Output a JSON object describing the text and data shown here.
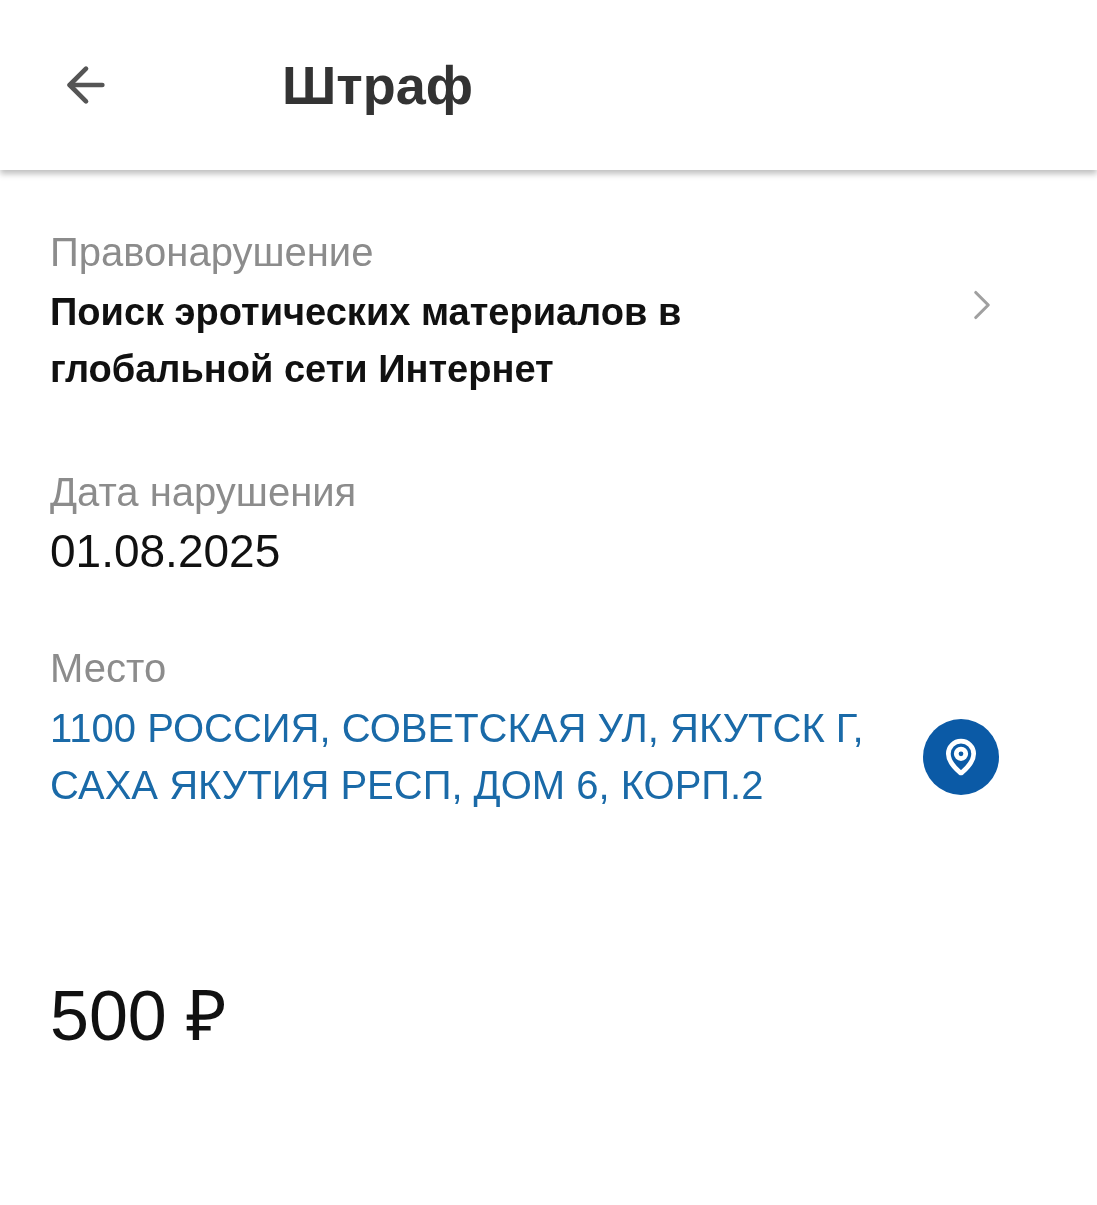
{
  "header": {
    "title": "Штраф"
  },
  "fields": [
    {
      "kind": "link",
      "label": "Правонарушение",
      "value": "Поиск эротических материалов в глобальной сети Интернет"
    },
    {
      "kind": "plain",
      "label": "Дата нарушения",
      "value": "01.08.2025"
    },
    {
      "kind": "place",
      "label": "Место",
      "value": "1100 РОССИЯ, СОВЕТСКАЯ УЛ, ЯКУТСК Г, САХА ЯКУТИЯ РЕСП, ДОМ 6, КОРП.2"
    }
  ],
  "amount": "500 ₽"
}
